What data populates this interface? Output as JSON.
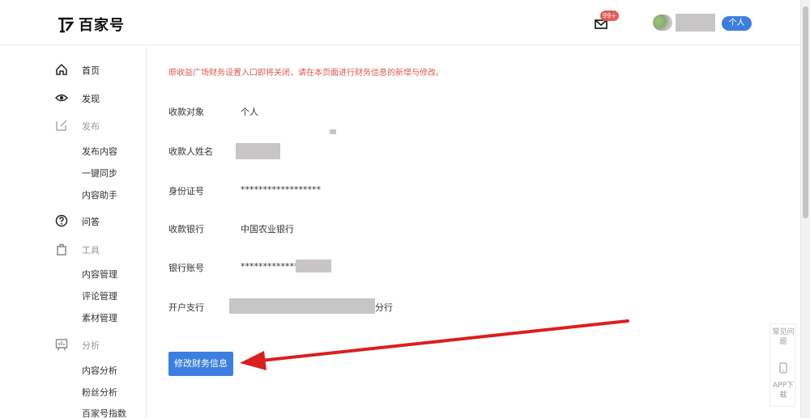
{
  "header": {
    "logo_text": "百家号",
    "mail_badge": "99+",
    "role_label": "个人"
  },
  "sidebar": {
    "home": "首页",
    "discover": "发现",
    "publish": "发布",
    "publish_items": [
      "发布内容",
      "一键同步",
      "内容助手"
    ],
    "qa": "问答",
    "tools": "工具",
    "tools_items": [
      "内容管理",
      "评论管理",
      "素材管理"
    ],
    "analysis": "分析",
    "analysis_items": [
      "内容分析",
      "粉丝分析",
      "百家号指数"
    ]
  },
  "main": {
    "notice": "原收益广场财务设置入口即将关闭，请在本页面进行财务信息的新增与修改。",
    "rows": [
      {
        "label": "收款对象",
        "value": "个人"
      },
      {
        "label": "收款人姓名",
        "value": ""
      },
      {
        "label": "身份证号",
        "value": "******************"
      },
      {
        "label": "收款银行",
        "value": "中国农业银行"
      },
      {
        "label": "银行账号",
        "value": "**************"
      },
      {
        "label": "开户支行",
        "value": "分行"
      }
    ],
    "edit_button": "修改财务信息"
  },
  "float_panel": {
    "faq": "常见问题",
    "app": "APP下载"
  },
  "colors": {
    "accent": "#3d7fe0",
    "notice": "#e0574f",
    "arrow": "#d9201f",
    "badge": "#e85b5b"
  }
}
